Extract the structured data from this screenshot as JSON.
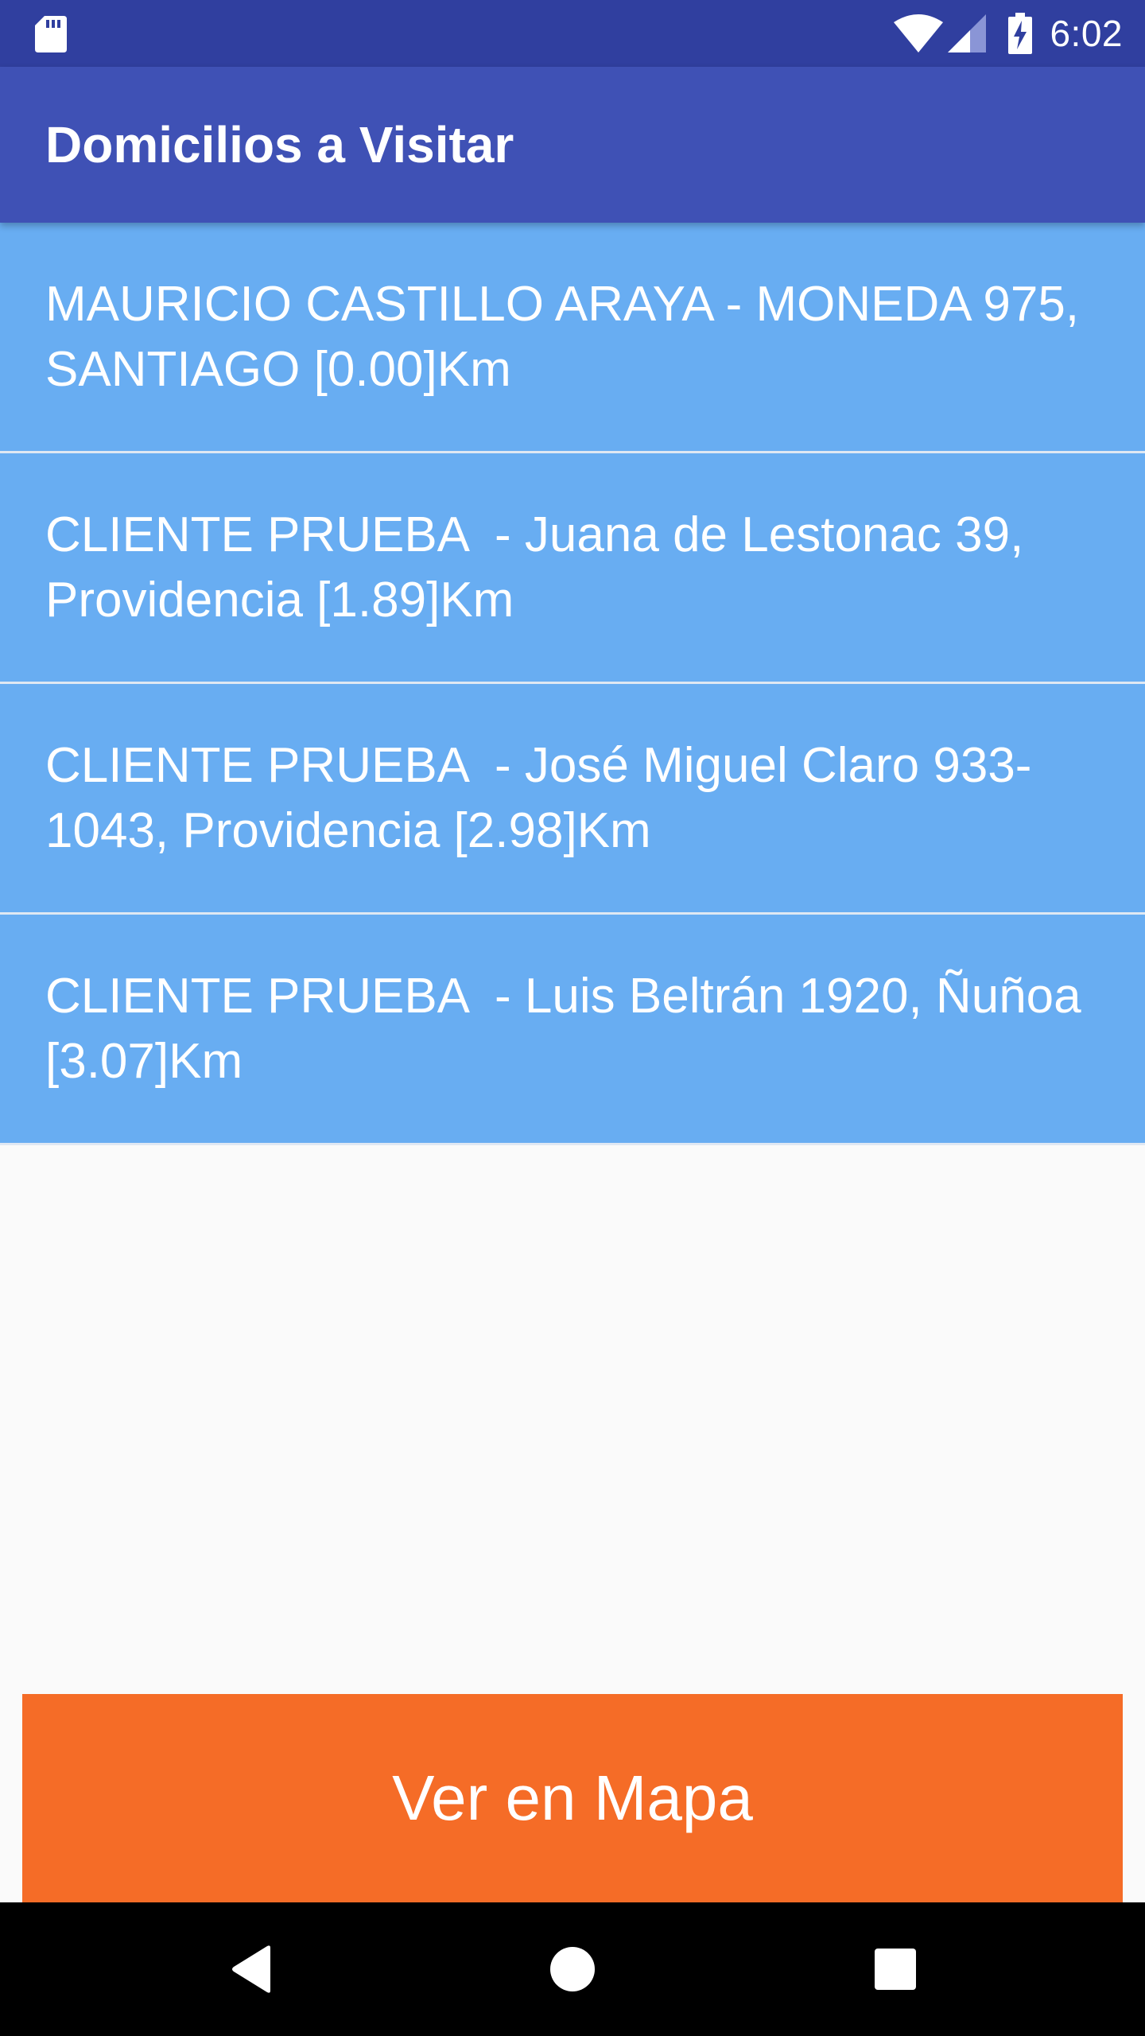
{
  "status_bar": {
    "time": "6:02",
    "icons": [
      "sd-card-icon",
      "wifi-icon",
      "signal-icon",
      "battery-charging-icon"
    ]
  },
  "toolbar": {
    "title": "Domicilios a Visitar"
  },
  "addresses": [
    {
      "label": "MAURICIO CASTILLO ARAYA - MONEDA 975, SANTIAGO [0.00]Km"
    },
    {
      "label": "CLIENTE PRUEBA  - Juana de Lestonac 39, Providencia [1.89]Km"
    },
    {
      "label": "CLIENTE PRUEBA  - José Miguel Claro 933-1043, Providencia [2.98]Km"
    },
    {
      "label": "CLIENTE PRUEBA  - Luis Beltrán 1920, Ñuñoa [3.07]Km"
    }
  ],
  "map_button": {
    "label": "Ver en Mapa"
  },
  "nav_bar": {
    "icons": [
      "back-icon",
      "home-icon",
      "recents-icon"
    ]
  },
  "colors": {
    "status_bar": "#303f9f",
    "toolbar": "#3f51b5",
    "list_item": "#68adf2",
    "button": "#f56c27",
    "background": "#fafafa"
  }
}
